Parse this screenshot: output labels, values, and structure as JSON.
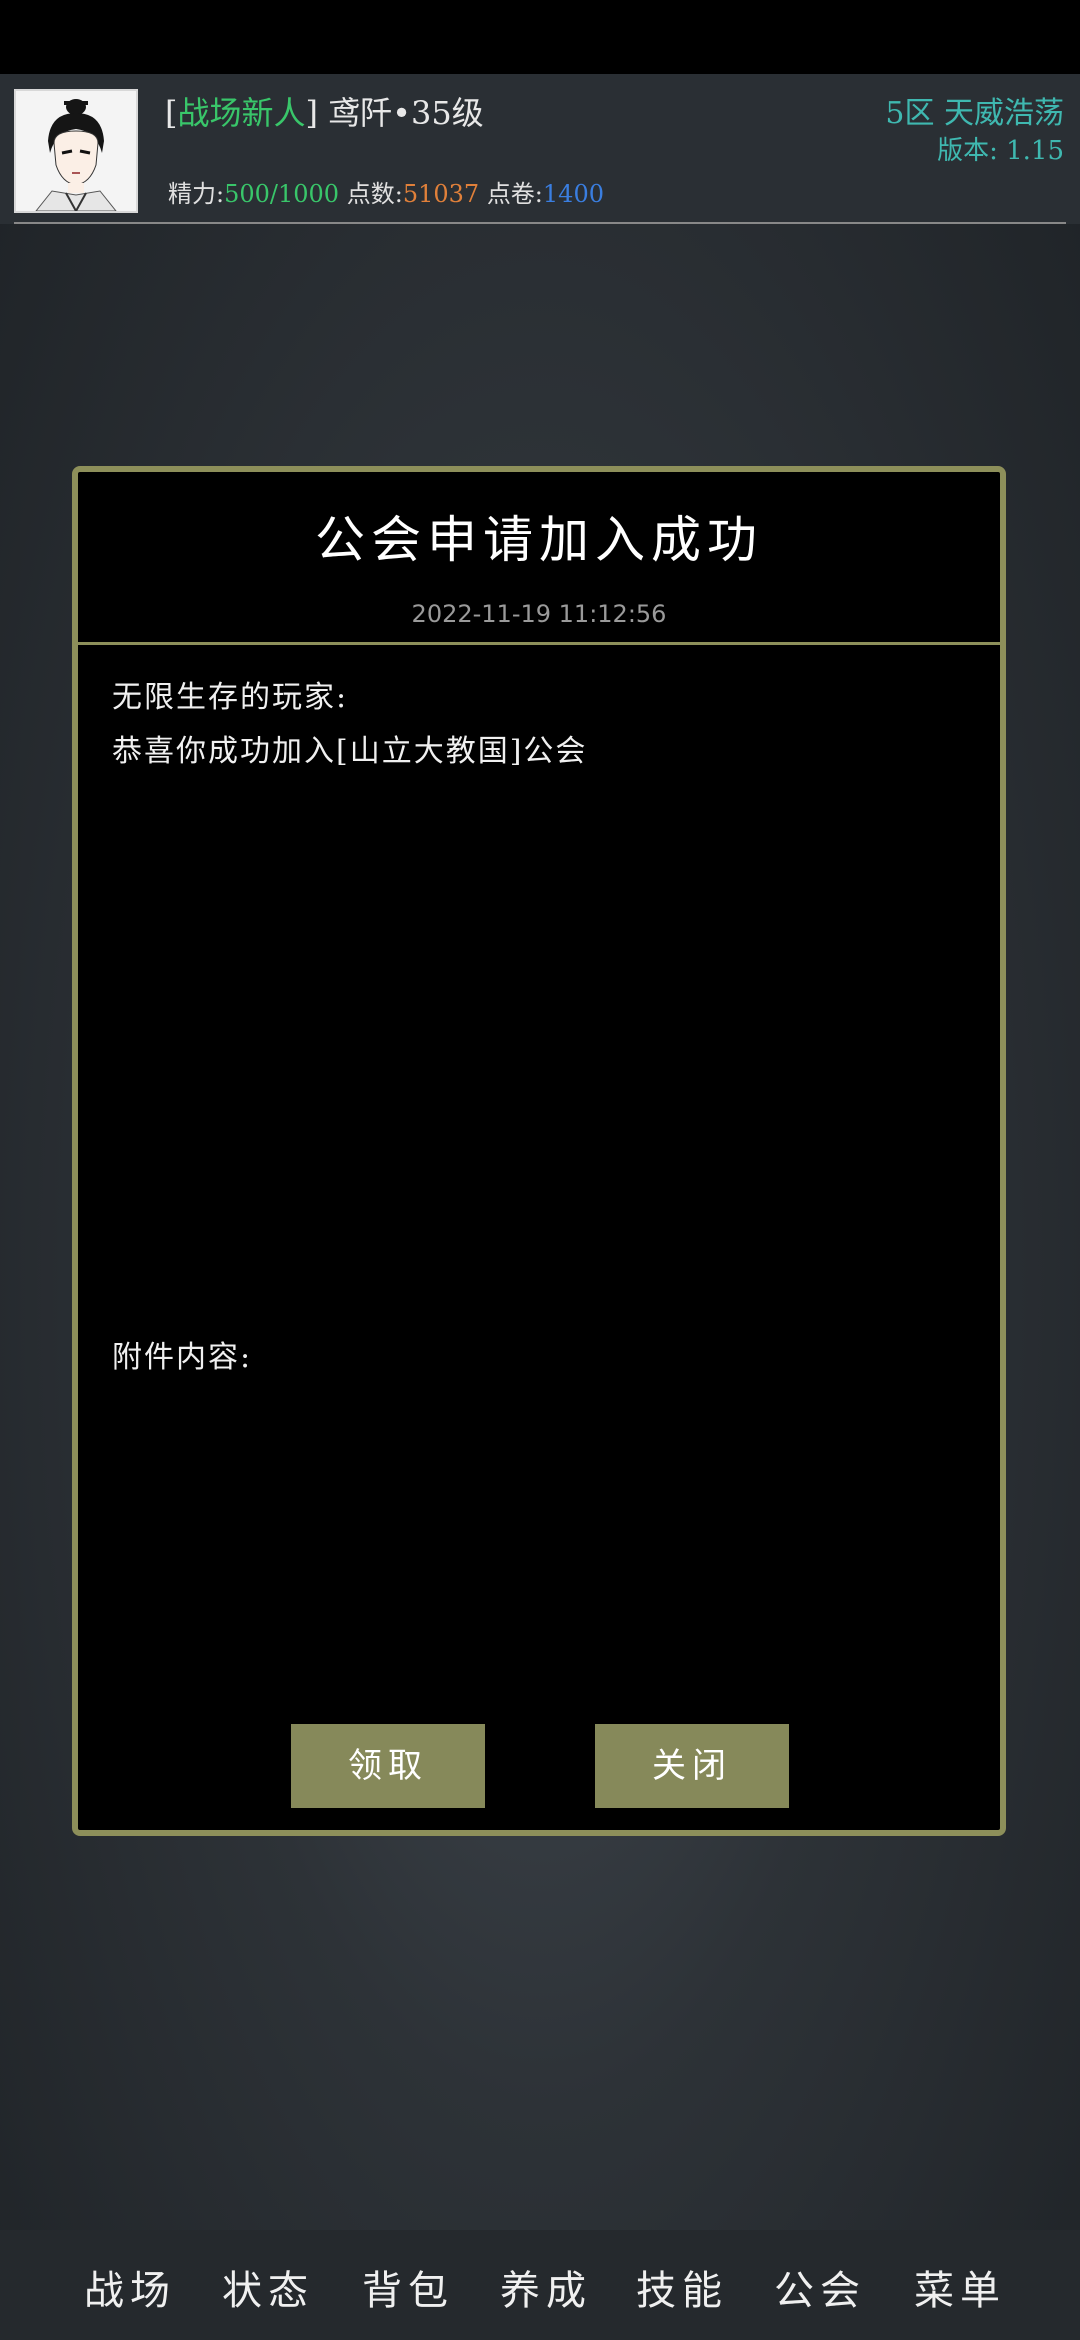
{
  "header": {
    "title_bracket_open": "[",
    "rank_tag": "战场新人",
    "title_bracket_close": "]",
    "player_level": "鸢阡•35级",
    "stamina_label": "精力:",
    "stamina_value": "500/1000",
    "points_label": "点数:",
    "points_value": "51037",
    "coupons_label": "点卷:",
    "coupons_value": "1400",
    "server": "5区  天威浩荡",
    "version": "版本: 1.15"
  },
  "dialog": {
    "title": "公会申请加入成功",
    "date": "2022-11-19 11:12:56",
    "greeting": "无限生存的玩家:",
    "message": "恭喜你成功加入[山立大教国]公会",
    "attachment_label": "附件内容:",
    "claim_button": "领取",
    "close_button": "关闭"
  },
  "nav": {
    "items": [
      "战场",
      "状态",
      "背包",
      "养成",
      "技能",
      "公会",
      "菜单"
    ]
  },
  "colors": {
    "accent_border": "#8d8f5a",
    "button_bg": "#86895a",
    "rank_green": "#39c66a",
    "points_orange": "#e0803a",
    "coupons_blue": "#3a7ee0",
    "server_teal": "#3fb8b0"
  }
}
